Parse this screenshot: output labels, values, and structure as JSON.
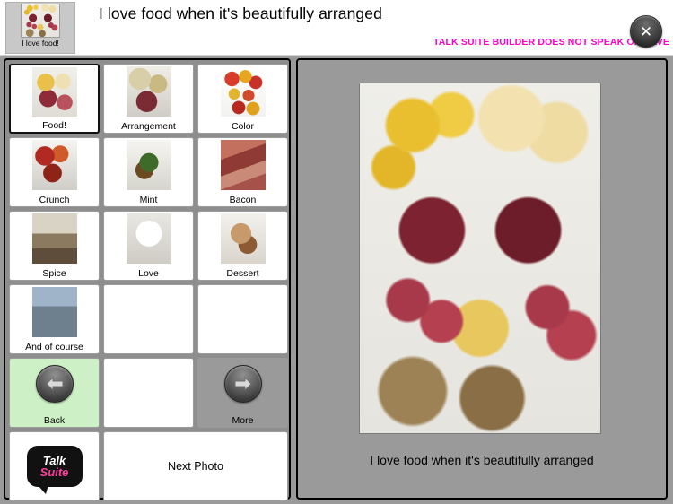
{
  "header": {
    "title": "I love food when it's beautifully arranged",
    "notice": "TALK SUITE BUILDER DOES NOT SPEAK OR SAVE",
    "notice_color": "#ff00c8",
    "thumb_label": "I love food!",
    "thumb_icon": "food-platter-photo",
    "close_icon": "close-x-icon",
    "close_label": "✕"
  },
  "grid": {
    "cells": [
      {
        "label": "Food!",
        "icon": "food-platter-photo",
        "type": "photo",
        "selected": true
      },
      {
        "label": "Arrangement",
        "icon": "arrangement-photo",
        "type": "photo",
        "selected": false
      },
      {
        "label": "Color",
        "icon": "colorful-peppers-photo",
        "type": "photo",
        "selected": false
      },
      {
        "label": "Crunch",
        "icon": "crunch-photo",
        "type": "photo",
        "selected": false
      },
      {
        "label": "Mint",
        "icon": "mint-photo",
        "type": "photo",
        "selected": false
      },
      {
        "label": "Bacon",
        "icon": "bacon-photo",
        "type": "photo",
        "selected": false
      },
      {
        "label": "Spice",
        "icon": "spice-photo",
        "type": "photo",
        "selected": false
      },
      {
        "label": "Love",
        "icon": "love-cup-photo",
        "type": "photo",
        "selected": false
      },
      {
        "label": "Dessert",
        "icon": "dessert-photo",
        "type": "photo",
        "selected": false
      },
      {
        "label": "And of course",
        "icon": "people-photo",
        "type": "photo",
        "selected": false
      },
      {
        "label": "",
        "icon": "",
        "type": "empty",
        "selected": false
      },
      {
        "label": "",
        "icon": "",
        "type": "empty",
        "selected": false
      },
      {
        "label": "Back",
        "icon": "arrow-left-icon",
        "type": "nav-back",
        "selected": false
      },
      {
        "label": "",
        "icon": "",
        "type": "empty",
        "selected": false
      },
      {
        "label": "More",
        "icon": "arrow-right-icon",
        "type": "nav-more",
        "selected": false
      }
    ],
    "logo": {
      "line1": "Talk",
      "line2": "Suite",
      "icon": "talk-suite-logo"
    },
    "next_photo_label": "Next Photo"
  },
  "preview": {
    "image_icon": "charcuterie-board-photo",
    "caption": "I love food when it's beautifully arranged"
  }
}
